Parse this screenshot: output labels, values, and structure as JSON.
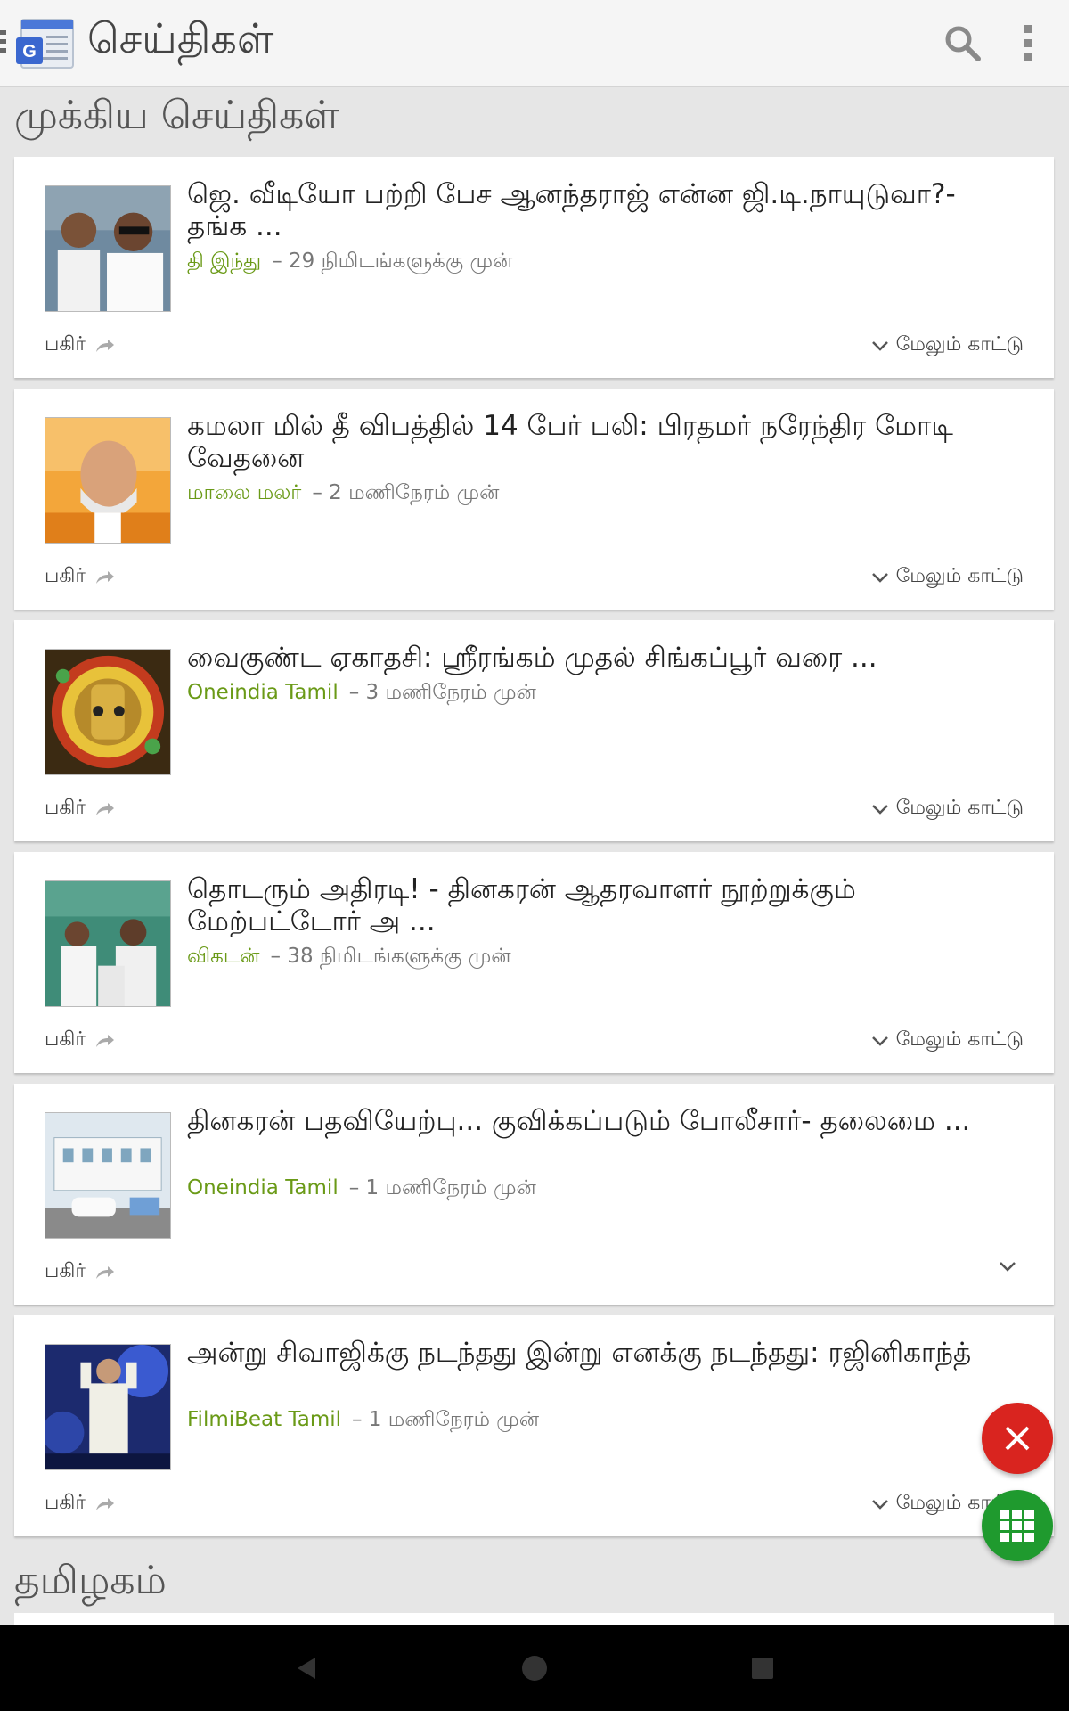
{
  "app": {
    "title": "செய்திகள்"
  },
  "sections": {
    "top_stories": "முக்கிய செய்திகள்",
    "tamilnadu": "தமிழகம்"
  },
  "labels": {
    "share": "பகிர்",
    "show_more": "மேலும் காட்டு"
  },
  "cards": [
    {
      "headline": "ஜெ. வீடியோ பற்றி பேச ஆனந்தராஜ் என்ன ஜி.டி.நாயுடுவா?- தங்க ...",
      "source": "தி இந்து",
      "time": "– 29 நிமிடங்களுக்கு முன்"
    },
    {
      "headline": "கமலா மில் தீ விபத்தில் 14 பேர் பலி: பிரதமர் நரேந்திர மோடி வேதனை",
      "source": "மாலை மலர்",
      "time": "– 2 மணிநேரம் முன்"
    },
    {
      "headline": "வைகுண்ட ஏகாதசி: ஸ்ரீரங்கம் முதல் சிங்கப்பூர் வரை ...",
      "source": "Oneindia Tamil",
      "time": "– 3 மணிநேரம் முன்"
    },
    {
      "headline": "தொடரும் அதிரடி! - தினகரன் ஆதரவாளர் நூற்றுக்கும் மேற்பட்டோர் அ ...",
      "source": "விகடன்",
      "time": "– 38 நிமிடங்களுக்கு முன்"
    },
    {
      "headline": "தினகரன் பதவியேற்பு... குவிக்கப்படும் போலீசார்- தலைமை ...",
      "source": "Oneindia Tamil",
      "time": "– 1 மணிநேரம் முன்"
    },
    {
      "headline": "அன்று சிவாஜிக்கு நடந்தது இன்று எனக்கு நடந்தது: ரஜினிகாந்த்",
      "source": "FilmiBeat Tamil",
      "time": "– 1 மணிநேரம் முன்"
    }
  ]
}
